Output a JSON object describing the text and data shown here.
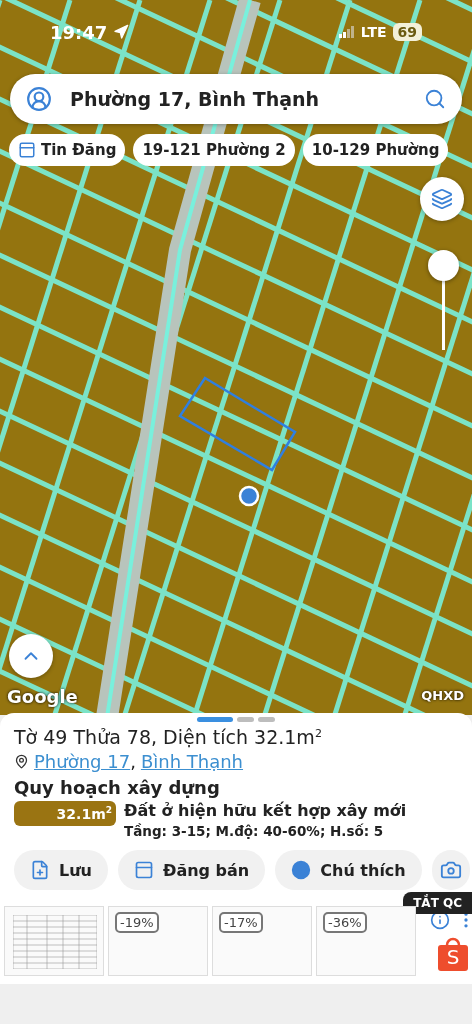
{
  "status_bar": {
    "time": "19:47",
    "network": "LTE",
    "battery": "69"
  },
  "search": {
    "value": "Phường 17, Bình Thạnh"
  },
  "chips": [
    {
      "label": "Tin Đăng",
      "kind": "icon"
    },
    {
      "label": "19-121 Phường 2",
      "kind": "text"
    },
    {
      "label": "10-129 Phường",
      "kind": "text"
    }
  ],
  "map": {
    "attribution": "Google",
    "layer_label": "QHXD",
    "zoom_slider": {
      "level": 1
    }
  },
  "sheet": {
    "pages": [
      {
        "selected": true
      },
      {
        "selected": false
      },
      {
        "selected": false
      }
    ],
    "title": "Tờ 49 Thửa 78, Diện tích 32.1m$^{2}$",
    "location": {
      "links": [
        "Phường 17",
        "Bình Thạnh"
      ],
      "separator": ","
    },
    "section_title": "Quy hoạch xây dựng",
    "zones": [
      {
        "area": "32.1m$^{2}$",
        "color": "#9a7412",
        "name": "Đất ở hiện hữu kết hợp xây mới",
        "details": "Tầng: 3-15; M.độ: 40-60%; H.số: 5"
      }
    ],
    "actions": [
      {
        "label": "Lưu",
        "kind": "save"
      },
      {
        "label": "Đăng bán",
        "kind": "post"
      },
      {
        "label": "Chú thích",
        "kind": "legend"
      },
      {
        "kind": "camera"
      }
    ]
  },
  "ads": {
    "close_label": "TẮT QC",
    "brand_mark": "S",
    "items": [
      {
        "kind": "table"
      },
      {
        "kind": "badge",
        "badge": "-19%"
      },
      {
        "kind": "badge",
        "badge": "-17%"
      },
      {
        "kind": "badge",
        "badge": "-36%"
      }
    ]
  }
}
